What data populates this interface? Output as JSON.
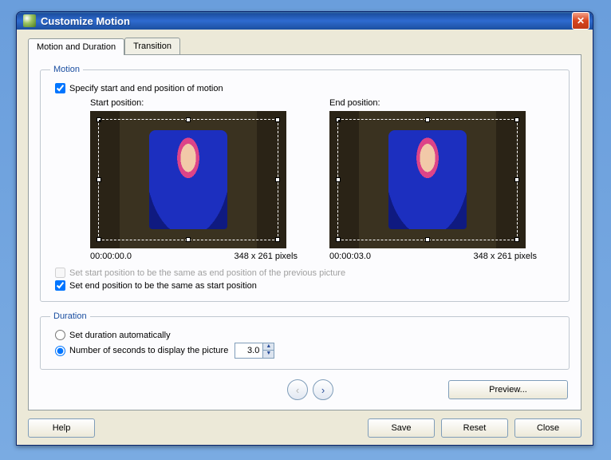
{
  "window": {
    "title": "Customize Motion"
  },
  "tabs": {
    "motion": "Motion and Duration",
    "transition": "Transition"
  },
  "motion": {
    "legend": "Motion",
    "specify": "Specify start and end position of motion",
    "start_label": "Start position:",
    "end_label": "End position:",
    "start_time": "00:00:00.0",
    "start_dim": "348 x 261 pixels",
    "end_time": "00:00:03.0",
    "end_dim": "348 x 261 pixels",
    "set_start_same": "Set start position to be the same as end position of the previous picture",
    "set_end_same": "Set end position to be the same as start position"
  },
  "duration": {
    "legend": "Duration",
    "auto": "Set duration automatically",
    "seconds_label": "Number of seconds to display the picture",
    "seconds_value": "3.0"
  },
  "buttons": {
    "preview": "Preview...",
    "help": "Help",
    "save": "Save",
    "reset": "Reset",
    "close": "Close"
  }
}
